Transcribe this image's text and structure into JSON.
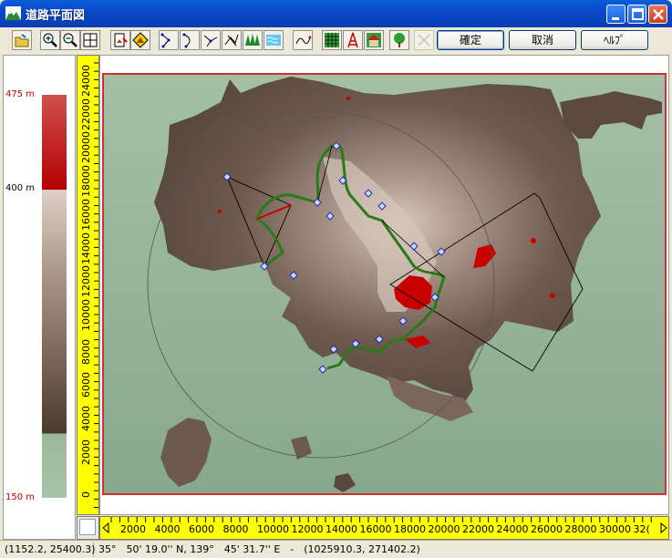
{
  "window": {
    "title": "道路平面図",
    "controls": [
      "minimize",
      "maximize",
      "close"
    ]
  },
  "toolbar": {
    "icons": [
      "open-folder-icon",
      "zoom-in-icon",
      "zoom-out-icon",
      "zoom-fit-icon",
      "image-export-icon",
      "mountain-marker-icon",
      "polyline-icon",
      "curve-icon",
      "branch-icon",
      "network-icon",
      "forest-icon",
      "water-icon",
      "path-edit-icon",
      "grid-select-icon",
      "tower-icon",
      "house-icon",
      "tree-icon",
      "disabled-cross-icon"
    ],
    "confirm_label": "確定",
    "cancel_label": "取消",
    "help_label": "ﾍﾙﾌﾟ"
  },
  "legend": {
    "max_label": "475 m",
    "mid_label": "400 m",
    "min_label": "150 m",
    "colors": {
      "high": "#c00000",
      "mid": "#d8c8bc",
      "low": "#4a3a30",
      "base": "#9ab89c"
    }
  },
  "vertical_ruler": {
    "ticks": [
      "24000",
      "22000",
      "20000",
      "18000",
      "16000",
      "14000",
      "12000",
      "10000",
      "8000",
      "6000",
      "4000",
      "2000",
      "0"
    ]
  },
  "horizontal_ruler": {
    "ticks": [
      "2000",
      "4000",
      "6000",
      "8000",
      "10000",
      "12000",
      "14000",
      "16000",
      "18000",
      "20000",
      "22000",
      "24000",
      "26000",
      "28000",
      "30000",
      "32("
    ]
  },
  "status": {
    "coords": "(1152.2, 25400.3)",
    "latlon": "35°　50' 19.0'' N, 139°　45' 31.7'' E　-　(1025910.3, 271402.2)"
  }
}
